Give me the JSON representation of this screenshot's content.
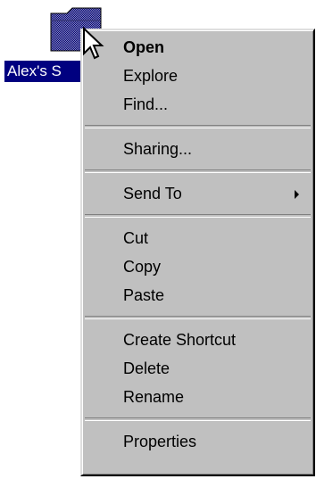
{
  "desktop": {
    "folder_label": "Alex's S",
    "folder_icon": "folder-icon"
  },
  "menu": {
    "items": [
      {
        "label": "Open",
        "default": true
      },
      {
        "label": "Explore"
      },
      {
        "label": "Find..."
      },
      {
        "separator": true
      },
      {
        "label": "Sharing..."
      },
      {
        "separator": true
      },
      {
        "label": "Send To",
        "submenu": true
      },
      {
        "separator": true
      },
      {
        "label": "Cut"
      },
      {
        "label": "Copy"
      },
      {
        "label": "Paste"
      },
      {
        "separator": true
      },
      {
        "label": "Create Shortcut"
      },
      {
        "label": "Delete"
      },
      {
        "label": "Rename"
      },
      {
        "separator": true
      },
      {
        "label": "Properties"
      }
    ]
  },
  "colors": {
    "selection": "#000080",
    "menu_face": "#c0c0c0",
    "folder_fill": "#7b7bb5"
  }
}
